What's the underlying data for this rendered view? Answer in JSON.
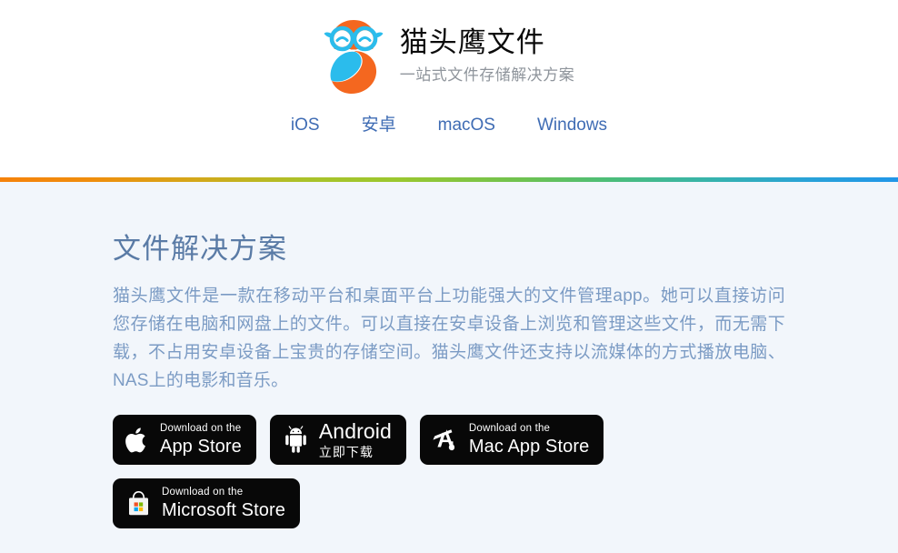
{
  "header": {
    "logo_icon": "owl-logo-icon",
    "brand_title": "猫头鹰文件",
    "brand_subtitle": "一站式文件存储解决方案",
    "nav": [
      {
        "label": "iOS",
        "name": "nav-link-ios"
      },
      {
        "label": "安卓",
        "name": "nav-link-android"
      },
      {
        "label": "macOS",
        "name": "nav-link-macos"
      },
      {
        "label": "Windows",
        "name": "nav-link-windows"
      }
    ],
    "accent_colors": {
      "start": "#f5820b",
      "mid_green": "#9bc72e",
      "end": "#2196e8"
    }
  },
  "main": {
    "section_title": "文件解决方案",
    "section_desc": "猫头鹰文件是一款在移动平台和桌面平台上功能强大的文件管理app。她可以直接访问您存储在电脑和网盘上的文件。可以直接在安卓设备上浏览和管理这些文件，而无需下载，不占用安卓设备上宝贵的存储空间。猫头鹰文件还支持以流媒体的方式播放电脑、NAS上的电影和音乐。",
    "badges": [
      {
        "name": "badge-app-store",
        "icon": "apple-icon",
        "small_text": "Download on the",
        "large_text": "App Store"
      },
      {
        "name": "badge-android",
        "icon": "android-icon",
        "small_text": "Android",
        "large_text": "立即下载"
      },
      {
        "name": "badge-mac-app-store",
        "icon": "mac-app-store-icon",
        "small_text": "Download on the",
        "large_text": "Mac App Store"
      },
      {
        "name": "badge-microsoft-store",
        "icon": "microsoft-store-icon",
        "small_text": "Download on the",
        "large_text": "Microsoft Store"
      }
    ]
  },
  "colors": {
    "page_bg": "#f2f6fb",
    "header_bg": "#ffffff",
    "nav_link": "#3f6cb4",
    "title_text": "#5a7ba6",
    "body_text": "#7b9bc4",
    "badge_bg": "#080808",
    "logo_orange": "#f4671f",
    "logo_cyan": "#2bbcec"
  }
}
